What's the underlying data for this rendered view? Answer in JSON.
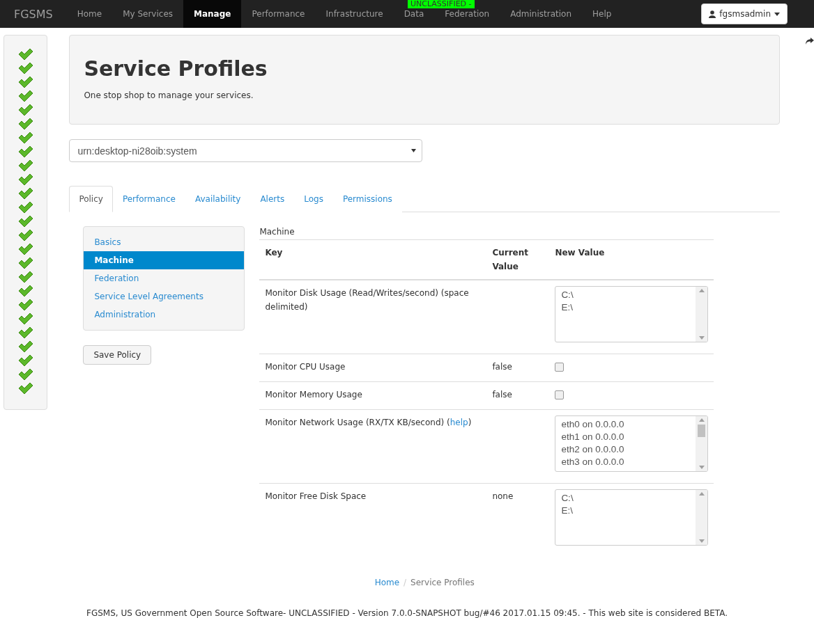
{
  "navbar": {
    "brand": "FGSMS",
    "items": [
      {
        "label": "Home",
        "selected": false
      },
      {
        "label": "My Services",
        "selected": false
      },
      {
        "label": "Manage",
        "selected": true
      },
      {
        "label": "Performance",
        "selected": false
      },
      {
        "label": "Infrastructure",
        "selected": false
      },
      {
        "label": "Data",
        "selected": false
      },
      {
        "label": "Federation",
        "selected": false
      },
      {
        "label": "Administration",
        "selected": false
      },
      {
        "label": "Help",
        "selected": false
      }
    ],
    "classification": "UNCLASSIFIED -",
    "user": "fgsmsadmin"
  },
  "status_checks": [
    {
      "ok": true
    },
    {
      "ok": true
    },
    {
      "ok": true
    },
    {
      "ok": true
    },
    {
      "ok": true
    },
    {
      "ok": true
    },
    {
      "ok": true
    },
    {
      "ok": true
    },
    {
      "ok": true
    },
    {
      "ok": true
    },
    {
      "ok": true
    },
    {
      "ok": true
    },
    {
      "ok": true
    },
    {
      "ok": true
    },
    {
      "ok": true
    },
    {
      "ok": true
    },
    {
      "ok": true
    },
    {
      "ok": true
    },
    {
      "ok": true
    },
    {
      "ok": true
    },
    {
      "ok": true
    },
    {
      "ok": true
    },
    {
      "ok": true
    },
    {
      "ok": true
    },
    {
      "ok": true
    }
  ],
  "header": {
    "title": "Service Profiles",
    "subtitle": "One stop shop to manage your services."
  },
  "service_select": {
    "value": "urn:desktop-ni28oib:system"
  },
  "tabs": [
    {
      "label": "Policy",
      "selected": true
    },
    {
      "label": "Performance",
      "selected": false
    },
    {
      "label": "Availability",
      "selected": false
    },
    {
      "label": "Alerts",
      "selected": false
    },
    {
      "label": "Logs",
      "selected": false
    },
    {
      "label": "Permissions",
      "selected": false
    }
  ],
  "sections": [
    {
      "label": "Basics",
      "selected": false
    },
    {
      "label": "Machine",
      "selected": true
    },
    {
      "label": "Federation",
      "selected": false
    },
    {
      "label": "Service Level Agreements",
      "selected": false
    },
    {
      "label": "Administration",
      "selected": false
    }
  ],
  "save_button": "Save Policy",
  "table": {
    "caption": "Machine",
    "columns": [
      "Key",
      "Current Value",
      "New Value"
    ],
    "rows": [
      {
        "key": "Monitor Disk Usage (Read/Writes/second) (space delimited)",
        "kind": "list",
        "options": [
          "C:\\",
          "E:\\"
        ]
      },
      {
        "key": "Monitor CPU Usage",
        "current": "false",
        "kind": "checkbox",
        "checked": false
      },
      {
        "key": "Monitor Memory Usage",
        "current": "false",
        "kind": "checkbox",
        "checked": false
      },
      {
        "key": "Monitor Network Usage (RX/TX KB/second) (",
        "link": "help",
        "key_end": ")",
        "kind": "list",
        "options": [
          "eth0 on 0.0.0.0",
          "eth1 on 0.0.0.0",
          "eth2 on 0.0.0.0",
          "eth3 on 0.0.0.0"
        ]
      },
      {
        "key": "Monitor Free Disk Space",
        "current": "none",
        "kind": "list",
        "options": [
          "C:\\",
          "E:\\"
        ]
      }
    ]
  },
  "breadcrumb": [
    {
      "label": "Home",
      "kind": "link"
    },
    {
      "label": "/",
      "kind": "separator"
    },
    {
      "label": "Service Profiles",
      "kind": "current"
    }
  ],
  "footer": "FGSMS, US Government Open Source Software- UNCLASSIFIED - Version 7.0.0-SNAPSHOT bug/#46 2017.01.15 09:45. - This web site is considered BETA."
}
